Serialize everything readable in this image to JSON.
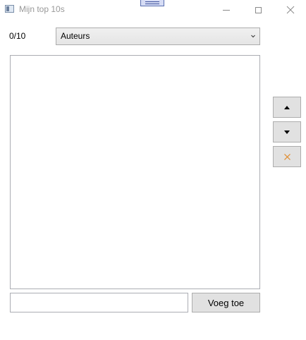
{
  "window": {
    "title": "Mijn top 10s"
  },
  "counter": {
    "text": "0/10"
  },
  "category_select": {
    "selected": "Auteurs"
  },
  "list": {
    "items": []
  },
  "side_buttons": {
    "up_icon": "triangle-up-icon",
    "down_icon": "triangle-down-icon",
    "remove_icon": "close-icon",
    "remove_color": "#e08a2a"
  },
  "entry": {
    "value": "",
    "placeholder": ""
  },
  "add_button": {
    "label": "Voeg toe"
  }
}
